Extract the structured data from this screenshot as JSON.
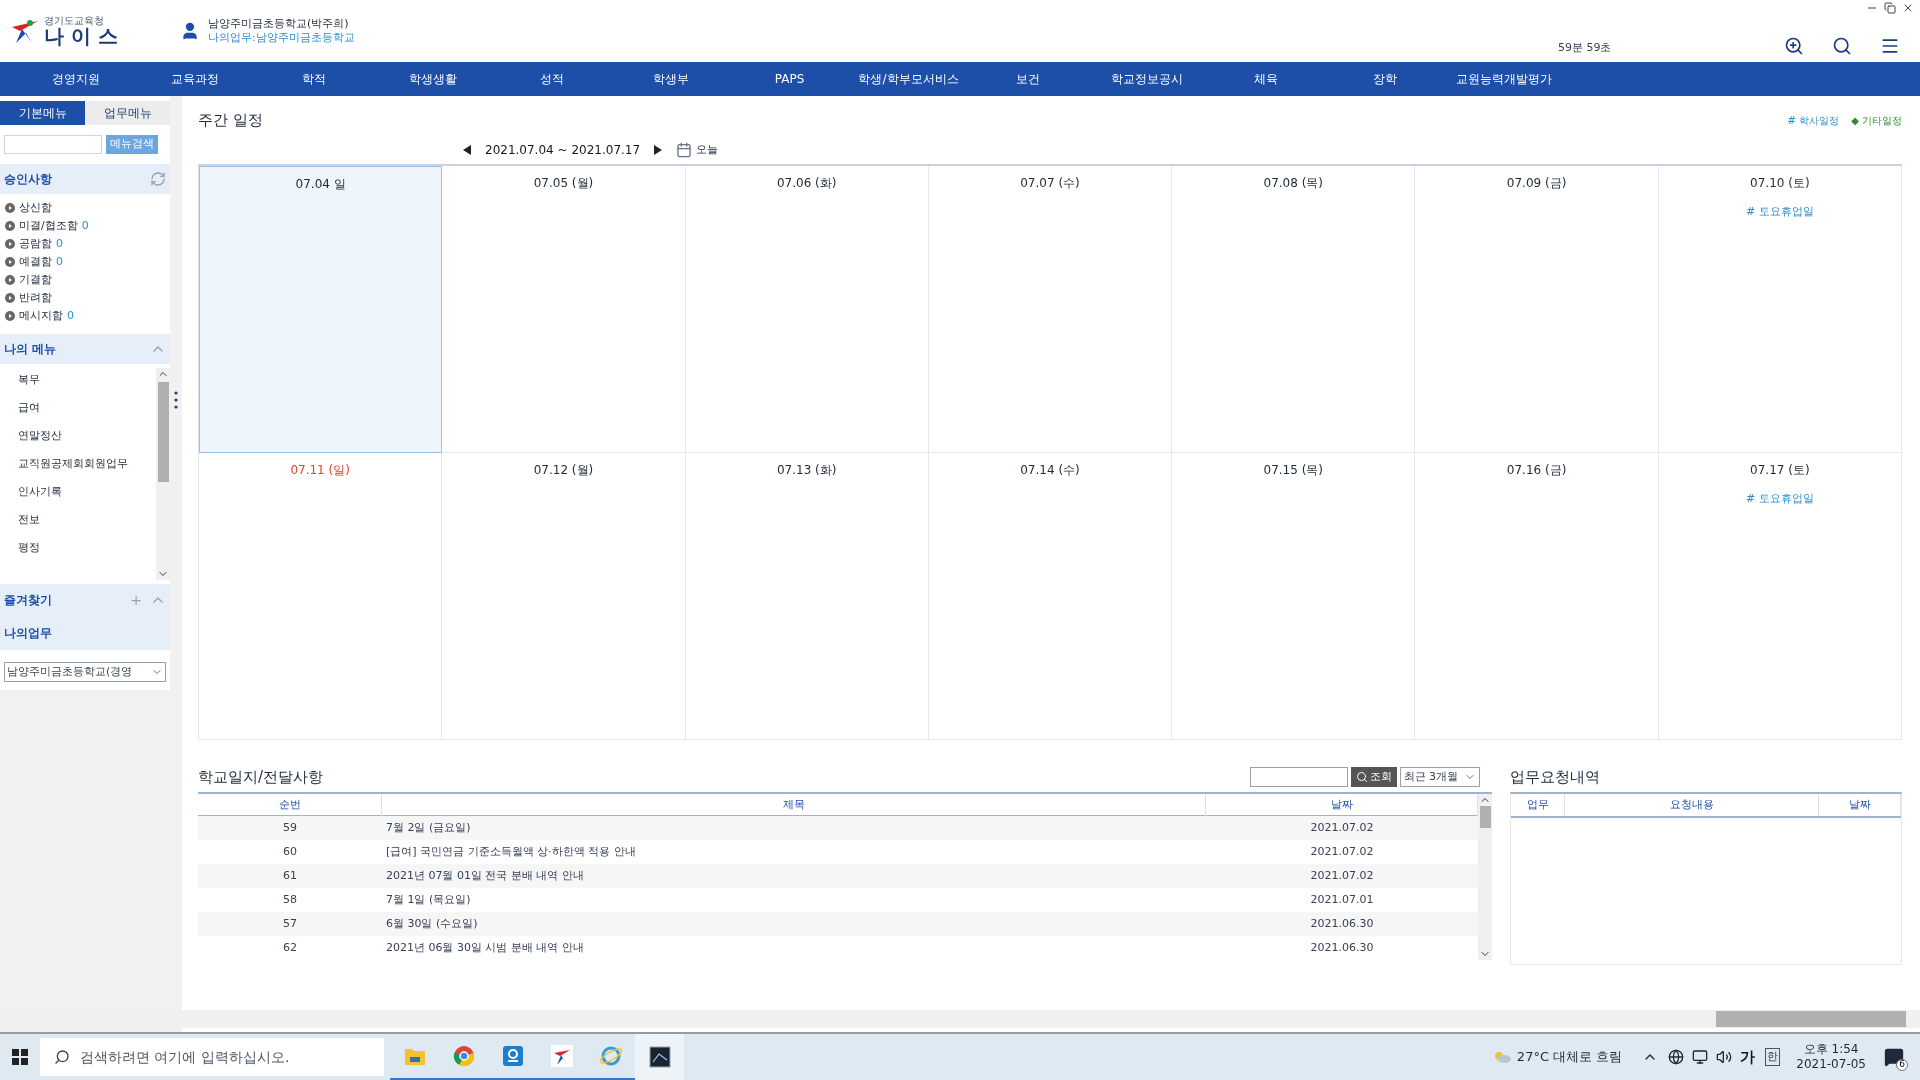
{
  "header": {
    "org": "경기도교육청",
    "logo": "나 이 스",
    "user": "남양주미금초등학교(박주희)",
    "user_link": "나의업무:남양주미금초등학교",
    "timer": "59분 59초"
  },
  "nav": [
    "경영지원",
    "교육과정",
    "학적",
    "학생생활",
    "성적",
    "학생부",
    "PAPS",
    "학생/학부모서비스",
    "보건",
    "학교정보공시",
    "체육",
    "장학",
    "교원능력개발평가"
  ],
  "sidebar": {
    "tabs": [
      {
        "label": "기본메뉴",
        "selected": true
      },
      {
        "label": "업무메뉴",
        "selected": false
      }
    ],
    "search_button": "메뉴검색",
    "approval": {
      "title": "승인사항",
      "items": [
        {
          "label": "상신함"
        },
        {
          "label": "미결/협조함",
          "count": "0"
        },
        {
          "label": "공람함",
          "count": "0"
        },
        {
          "label": "예결함",
          "count": "0"
        },
        {
          "label": "기결함"
        },
        {
          "label": "반려함"
        },
        {
          "label": "메시지함",
          "count": "0"
        }
      ]
    },
    "my_menu": {
      "title": "나의 메뉴",
      "items": [
        "복무",
        "급여",
        "연말정산",
        "교직원공제회회원업무",
        "인사기록",
        "전보",
        "평정"
      ]
    },
    "favorites": {
      "title": "즐겨찾기",
      "add": "+"
    },
    "my_work": {
      "title": "나의업무",
      "select": "남양주미금초등학교(경영"
    }
  },
  "calendar": {
    "title": "주간 일정",
    "legend": [
      {
        "label": "# 학사일정",
        "color": "#2a8fd0"
      },
      {
        "label": "◆ 기타일정",
        "color": "#2e8b2e"
      }
    ],
    "range": "2021.07.04 ~ 2021.07.17",
    "today": "오늘",
    "weeks": [
      [
        {
          "date": "07.04 일",
          "selected": true,
          "holiday": false
        },
        {
          "date": "07.05 (월)",
          "selected": false,
          "holiday": false
        },
        {
          "date": "07.06 (화)",
          "selected": false,
          "holiday": false
        },
        {
          "date": "07.07 (수)",
          "selected": false,
          "holiday": false
        },
        {
          "date": "07.08 (목)",
          "selected": false,
          "holiday": false
        },
        {
          "date": "07.09 (금)",
          "selected": false,
          "holiday": false
        },
        {
          "date": "07.10 (토)",
          "selected": false,
          "holiday": false,
          "events": [
            "# 토요휴업일"
          ]
        }
      ],
      [
        {
          "date": "07.11 (일)",
          "selected": false,
          "holiday": true
        },
        {
          "date": "07.12 (월)",
          "selected": false,
          "holiday": false
        },
        {
          "date": "07.13 (화)",
          "selected": false,
          "holiday": false
        },
        {
          "date": "07.14 (수)",
          "selected": false,
          "holiday": false
        },
        {
          "date": "07.15 (목)",
          "selected": false,
          "holiday": false
        },
        {
          "date": "07.16 (금)",
          "selected": false,
          "holiday": false
        },
        {
          "date": "07.17 (토)",
          "selected": false,
          "holiday": false,
          "events": [
            "# 토요휴업일"
          ]
        }
      ]
    ]
  },
  "notices": {
    "title": "학교일지/전달사항",
    "search_button": "조회",
    "period": "최근 3개월",
    "columns": [
      "순번",
      "제목",
      "날짜"
    ],
    "rows": [
      [
        "59",
        "7월 2일 (금요일)",
        "2021.07.02"
      ],
      [
        "60",
        "[급여] 국민연금 기준소득월액 상·하한액 적용 안내",
        "2021.07.02"
      ],
      [
        "61",
        "2021년 07월 01일 전국 분배 내역 안내",
        "2021.07.02"
      ],
      [
        "58",
        "7월 1일 (목요일)",
        "2021.07.01"
      ],
      [
        "57",
        "6월 30일 (수요일)",
        "2021.06.30"
      ],
      [
        "62",
        "2021년 06월 30일 시범 분배 내역 안내",
        "2021.06.30"
      ]
    ]
  },
  "requests": {
    "title": "업무요청내역",
    "columns": [
      "업무",
      "요청내용",
      "날짜"
    ]
  },
  "taskbar": {
    "search_placeholder": "검색하려면 여기에 입력하십시오.",
    "weather": "27°C 대체로 흐림",
    "ime": "가",
    "ime_mode": "한",
    "time": "오후 1:54",
    "date": "2021-07-05",
    "notifications": "6"
  }
}
